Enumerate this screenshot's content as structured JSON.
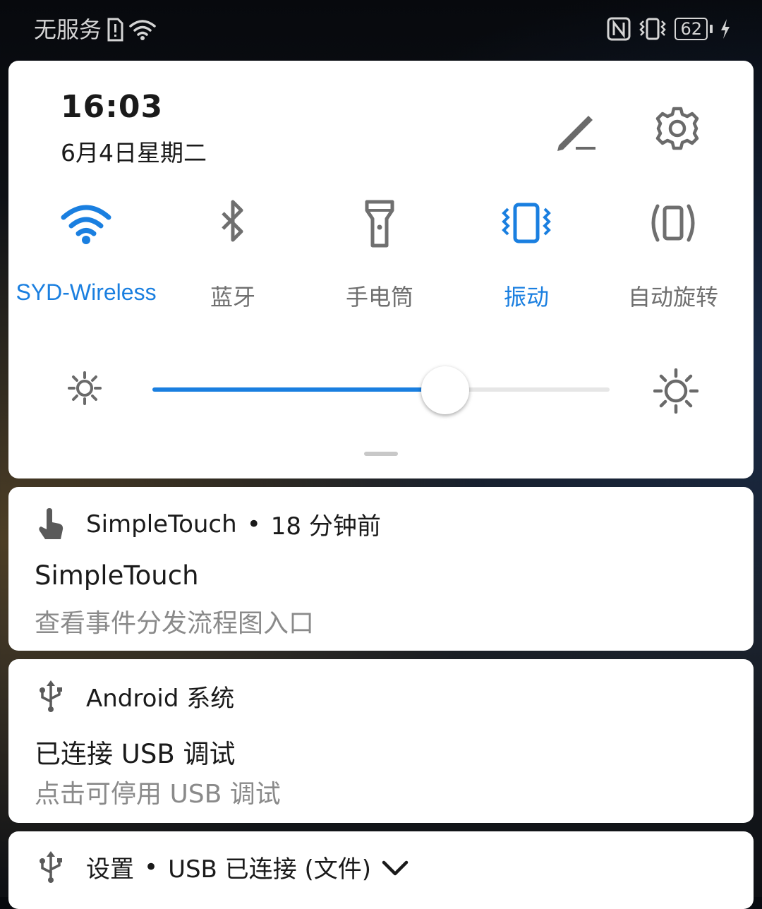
{
  "status_bar": {
    "carrier": "无服务",
    "battery": "62",
    "icons": [
      "sim-alert-icon",
      "wifi-icon",
      "nfc-icon",
      "vibrate-icon",
      "battery-icon",
      "charging-icon"
    ]
  },
  "quick_settings": {
    "time": "16:03",
    "date": "6月4日星期二",
    "tiles": [
      {
        "label": "SYD-Wireless",
        "icon": "wifi-icon",
        "active": true
      },
      {
        "label": "蓝牙",
        "icon": "bluetooth-icon",
        "active": false
      },
      {
        "label": "手电筒",
        "icon": "flashlight-icon",
        "active": false
      },
      {
        "label": "振动",
        "icon": "vibrate-icon",
        "active": true
      },
      {
        "label": "自动旋转",
        "icon": "auto-rotate-icon",
        "active": false
      }
    ],
    "brightness": 0.64,
    "colors": {
      "accent": "#1a7fe0",
      "inactive": "#6f6f6f"
    }
  },
  "notifications": [
    {
      "app": "SimpleTouch",
      "time": "18 分钟前",
      "title": "SimpleTouch",
      "text": "查看事件分发流程图入口",
      "icon": "touch-hand-icon"
    },
    {
      "app": "Android 系统",
      "title": "已连接 USB 调试",
      "text": "点击可停用 USB 调试",
      "icon": "usb-icon"
    },
    {
      "app": "设置",
      "time": "USB 已连接 (文件)",
      "icon": "usb-icon"
    }
  ]
}
